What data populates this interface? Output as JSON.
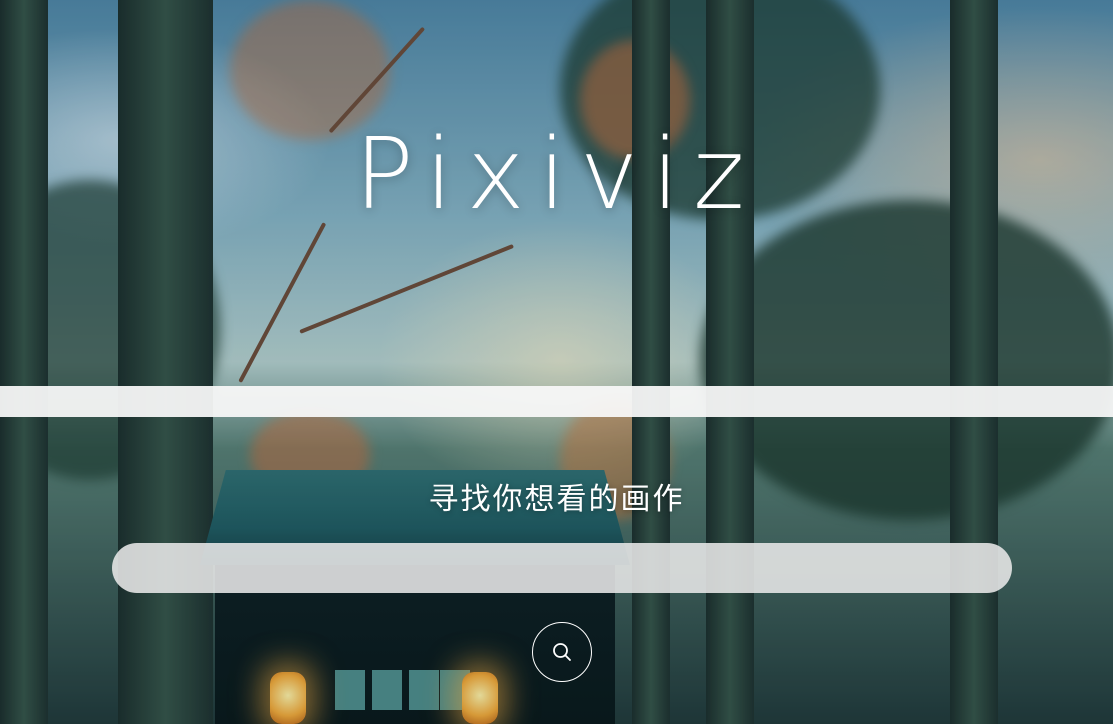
{
  "app": {
    "title": "Pixiviz",
    "subtitle": "寻找你想看的画作"
  },
  "search": {
    "value": "",
    "placeholder": "",
    "button_icon": "search-icon"
  },
  "colors": {
    "text": "#ffffff",
    "divider": "#f8f8f8",
    "input_background": "#e8e8e8"
  }
}
